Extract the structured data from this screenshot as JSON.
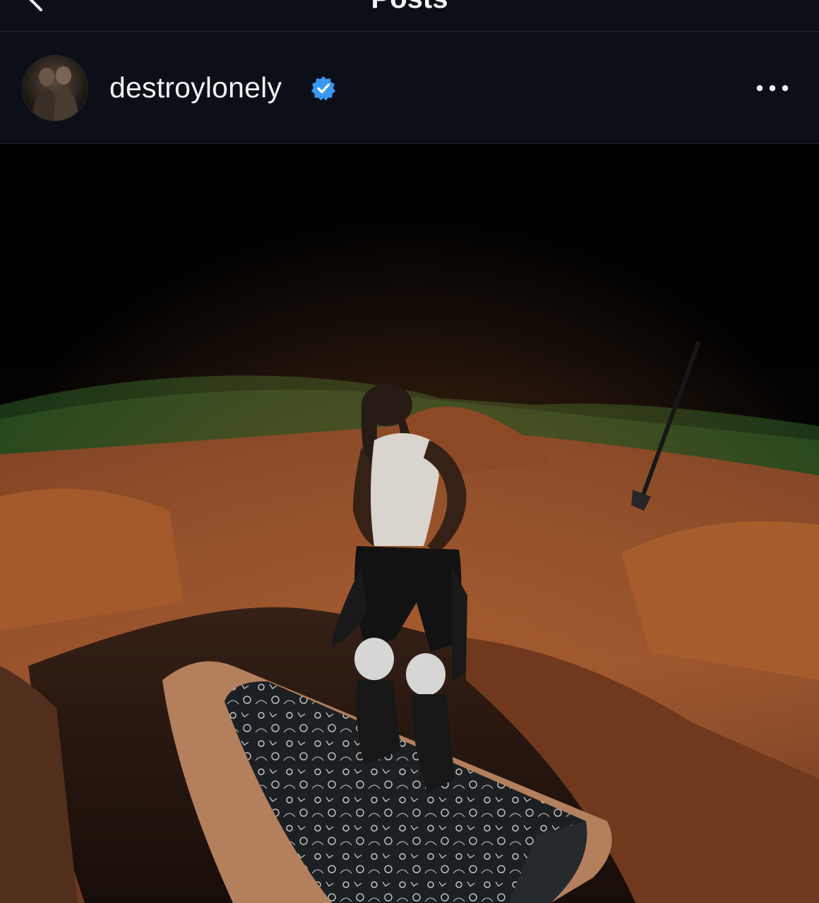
{
  "topbar": {
    "title": "Posts",
    "back_icon": "chevron-left-icon"
  },
  "post": {
    "username": "destroylonely",
    "verified_icon": "verified-badge-icon",
    "more_icon": "more-horizontal-icon",
    "image_subject": "photo"
  },
  "colors": {
    "background": "#0b0f18",
    "verified_blue": "#3897f0",
    "text": "#f5f5f5"
  }
}
